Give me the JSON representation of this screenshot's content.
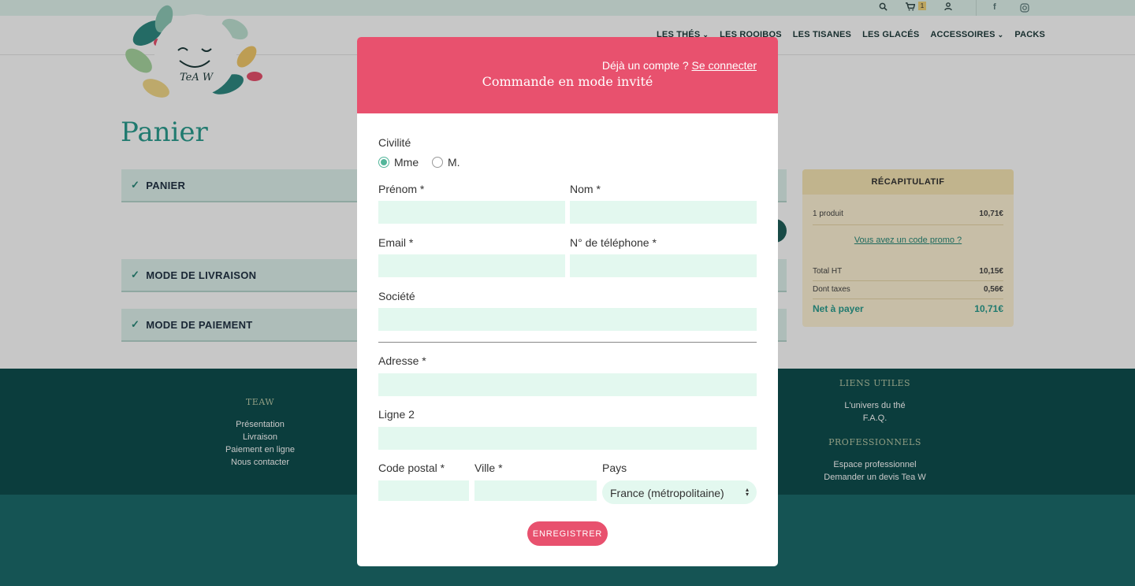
{
  "topbar": {
    "cart_count": "1",
    "icons": [
      "search-icon",
      "cart-icon",
      "user-icon",
      "facebook-icon",
      "instagram-icon"
    ]
  },
  "nav": {
    "items": [
      {
        "label": "LES THÉS",
        "dropdown": true
      },
      {
        "label": "LES ROOIBOS",
        "dropdown": false
      },
      {
        "label": "LES TISANES",
        "dropdown": false
      },
      {
        "label": "LES GLACÉS",
        "dropdown": false
      },
      {
        "label": "ACCESSOIRES",
        "dropdown": true
      },
      {
        "label": "PACKS",
        "dropdown": false
      }
    ]
  },
  "logo": {
    "text": "TeA W"
  },
  "page": {
    "title": "Panier"
  },
  "steps": [
    "PANIER",
    "MODE DE LIVRAISON",
    "MODE DE PAIEMENT"
  ],
  "recap": {
    "title": "RÉCAPITULATIF",
    "product_count": "1 produit",
    "product_total": "10,71€",
    "promo_link": "Vous avez un code promo ?",
    "total_ht_label": "Total HT",
    "total_ht": "10,15€",
    "taxes_label": "Dont taxes",
    "taxes": "0,56€",
    "net_label": "Net à payer",
    "net": "10,71€"
  },
  "footer": {
    "teaw": {
      "title": "TEAW",
      "links": [
        "Présentation",
        "Livraison",
        "Paiement en ligne",
        "Nous contacter"
      ]
    },
    "liens": {
      "title": "LIENS UTILES",
      "links": [
        "L'univers du thé",
        "F.A.Q."
      ]
    },
    "pro": {
      "title": "PROFESSIONNELS",
      "links": [
        "Espace professionnel",
        "Demander un devis Tea W"
      ]
    }
  },
  "modal": {
    "login_prompt": "Déjà un compte ?",
    "login_link": "Se connecter",
    "title": "Commande en mode invité",
    "civility_label": "Civilité",
    "civility_options": [
      "Mme",
      "M."
    ],
    "civility_selected": "Mme",
    "firstname_label": "Prénom *",
    "lastname_label": "Nom *",
    "email_label": "Email *",
    "phone_label": "N° de téléphone *",
    "company_label": "Société",
    "address_label": "Adresse *",
    "address2_label": "Ligne 2",
    "postcode_label": "Code postal *",
    "city_label": "Ville *",
    "country_label": "Pays",
    "country_value": "France (métropolitaine)",
    "submit": "ENREGISTRER"
  },
  "colors": {
    "accent": "#e8516e",
    "input_bg": "#e3f8ef",
    "teal": "#2a9d8f",
    "footer": "#0f4f4f"
  }
}
